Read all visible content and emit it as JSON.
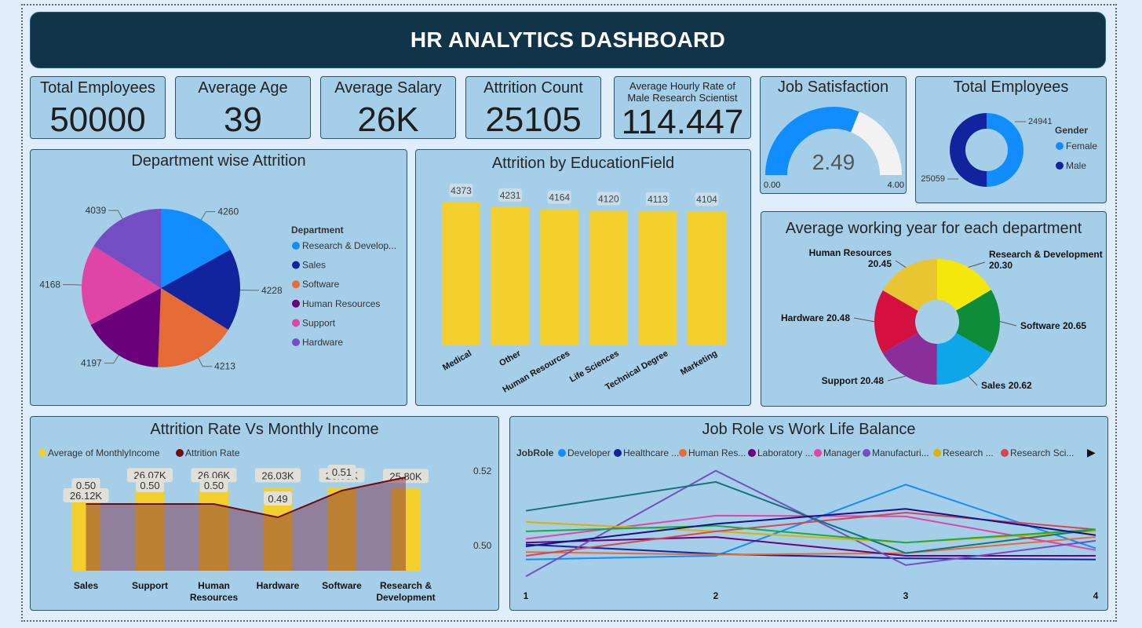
{
  "header": {
    "title": "HR ANALYTICS DASHBOARD"
  },
  "kpis": [
    {
      "label": "Total Employees",
      "value": "50000"
    },
    {
      "label": "Average Age",
      "value": "39"
    },
    {
      "label": "Average Salary",
      "value": "26K"
    },
    {
      "label": "Attrition Count",
      "value": "25105"
    },
    {
      "label_line1": "Average Hourly Rate of",
      "label_line2": "Male Research Scientist",
      "value": "114.447"
    }
  ],
  "colors": {
    "card_bg": "#a5cfe9",
    "header_bg": "#123449",
    "bar_yellow": "#f2cf2a",
    "attrition_line": "#6b0d0d",
    "gauge_fill": "#118dff",
    "gauge_empty": "#f2f2f2"
  },
  "chart_data": [
    {
      "id": "job_satisfaction",
      "type": "gauge",
      "title": "Job Satisfaction",
      "value": 2.49,
      "value_label": "2.49",
      "min": 0,
      "max": 4,
      "min_label": "0.00",
      "max_label": "4.00"
    },
    {
      "id": "gender_donut",
      "type": "pie",
      "title": "Total Employees",
      "legend_title": "Gender",
      "legend_position": "right",
      "series": [
        {
          "name": "Female",
          "value": 24941,
          "label": "24941",
          "color": "#118dff"
        },
        {
          "name": "Male",
          "value": 25059,
          "label": "25059",
          "color": "#12239e"
        }
      ]
    },
    {
      "id": "dept_attrition",
      "type": "pie",
      "title": "Department wise Attrition",
      "legend_title": "Department",
      "legend_position": "right",
      "series": [
        {
          "name": "Research & Develop...",
          "value": 4260,
          "label": "4260",
          "color": "#118dff"
        },
        {
          "name": "Sales",
          "value": 4228,
          "label": "4228",
          "color": "#12239e"
        },
        {
          "name": "Software",
          "value": 4213,
          "label": "4213",
          "color": "#e66c37"
        },
        {
          "name": "Human Resources",
          "value": 4197,
          "label": "4197",
          "color": "#6b007b"
        },
        {
          "name": "Support",
          "value": 4168,
          "label": "4168",
          "color": "#e044a7"
        },
        {
          "name": "Hardware",
          "value": 4039,
          "label": "4039",
          "color": "#744ec2"
        }
      ]
    },
    {
      "id": "edu_attrition",
      "type": "bar",
      "title": "Attrition by EducationField",
      "categories": [
        "Medical",
        "Other",
        "Human Resources",
        "Life Sciences",
        "Technical Degree",
        "Marketing"
      ],
      "values": [
        4373,
        4231,
        4164,
        4120,
        4113,
        4104
      ],
      "value_labels": [
        "4373",
        "4231",
        "4164",
        "4120",
        "4113",
        "4104"
      ],
      "ylim": [
        0,
        4373
      ]
    },
    {
      "id": "avg_working_year",
      "type": "pie",
      "title": "Average working year for each department",
      "series": [
        {
          "name": "Research & Development",
          "value": 20.3,
          "label_line1": "Research & Development",
          "label_line2": "20.30",
          "color": "#f5e60c"
        },
        {
          "name": "Software",
          "value": 20.65,
          "label_line1": "Software 20.65",
          "label_line2": "",
          "color": "#0e8c3a"
        },
        {
          "name": "Sales",
          "value": 20.62,
          "label_line1": "Sales 20.62",
          "label_line2": "",
          "color": "#0ea5e9"
        },
        {
          "name": "Support",
          "value": 20.48,
          "label_line1": "Support 20.48",
          "label_line2": "",
          "color": "#8a2e9a"
        },
        {
          "name": "Hardware",
          "value": 20.48,
          "label_line1": "Hardware 20.48",
          "label_line2": "",
          "color": "#d4103e"
        },
        {
          "name": "Human Resources",
          "value": 20.45,
          "label_line1": "Human Resources",
          "label_line2": "20.45",
          "color": "#e8c531"
        }
      ]
    },
    {
      "id": "attrition_vs_income",
      "type": "bar",
      "title": "Attrition Rate Vs Monthly Income",
      "legend_position": "top-left",
      "categories": [
        "Sales",
        "Support",
        "Human Resources",
        "Hardware",
        "Software",
        "Research & Development"
      ],
      "category_lines": [
        [
          "Sales"
        ],
        [
          "Support"
        ],
        [
          "Human",
          "Resources"
        ],
        [
          "Hardware"
        ],
        [
          "Software"
        ],
        [
          "Research &",
          "Development"
        ]
      ],
      "series": [
        {
          "name": "Average of MonthlyIncome",
          "values": [
            26120,
            26070,
            26060,
            26030,
            26030,
            25800
          ],
          "labels": [
            "26.12K",
            "26.07K",
            "26.06K",
            "26.03K",
            "26.03K",
            "25.80K"
          ],
          "color": "#f2cf2a"
        },
        {
          "name": "Attrition Rate",
          "values": [
            0.5,
            0.5,
            0.5,
            0.49,
            0.51,
            0.52
          ],
          "labels": [
            "0.50",
            "0.50",
            "0.50",
            "0.49",
            "0.51",
            ""
          ],
          "color": "#6b0d0d"
        }
      ],
      "ylim": [
        0,
        27000
      ],
      "y2lim": [
        0.45,
        0.53
      ]
    },
    {
      "id": "jobrole_wlb",
      "type": "line",
      "title": "Job Role vs Work Life Balance",
      "legend_title": "JobRole",
      "legend_position": "top",
      "x": [
        1,
        2,
        3,
        4
      ],
      "x_tick_labels": [
        "1",
        "2",
        "3",
        "4"
      ],
      "y_tick_labels": [
        "0.52",
        "0.50"
      ],
      "y_ticks": [
        0.52,
        0.5
      ],
      "ylim": [
        0.491,
        0.522
      ],
      "series": [
        {
          "name": "Developer",
          "color": "#118dff",
          "values": [
            0.4965,
            0.4975,
            0.5165,
            0.4995
          ]
        },
        {
          "name": "Healthcare ...",
          "color": "#12239e",
          "values": [
            0.5005,
            0.498,
            0.4968,
            0.4965
          ]
        },
        {
          "name": "Human Res...",
          "color": "#e66c37",
          "values": [
            0.4985,
            0.4978,
            0.4982,
            0.5025
          ]
        },
        {
          "name": "Laboratory ...",
          "color": "#6b007b",
          "values": [
            0.501,
            0.5025,
            0.4975,
            0.4975
          ]
        },
        {
          "name": "Manager",
          "color": "#e044a7",
          "values": [
            0.502,
            0.5082,
            0.508,
            0.499
          ]
        },
        {
          "name": "Manufacturi...",
          "color": "#744ec2",
          "values": [
            0.492,
            0.5202,
            0.495,
            0.5015
          ]
        },
        {
          "name": "Research ...",
          "color": "#d9b300",
          "values": [
            0.5065,
            0.504,
            0.501,
            0.504
          ]
        },
        {
          "name": "Research Sci...",
          "color": "#d64550",
          "values": [
            0.4975,
            0.504,
            0.509,
            0.5045
          ]
        },
        {
          "name": "",
          "color": "#197278",
          "values": [
            0.5095,
            0.5172,
            0.4982,
            0.5045
          ]
        },
        {
          "name": "",
          "color": "#1aab40",
          "values": [
            0.504,
            0.5055,
            0.501,
            0.5045
          ]
        },
        {
          "name": "",
          "color": "#15108a",
          "values": [
            0.5,
            0.506,
            0.51,
            0.503
          ]
        }
      ]
    }
  ]
}
